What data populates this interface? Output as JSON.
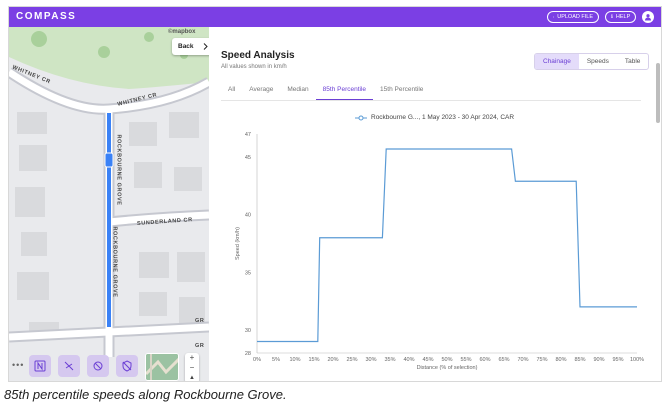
{
  "app": {
    "logo": "COMPASS",
    "upload_label": "UPLOAD FILE",
    "help_label": "HELP",
    "accent": "#7b3fe4"
  },
  "map": {
    "back_label": "Back",
    "attribution": "©mapbox",
    "streets": {
      "whitney_upper": "WHITNEY CR",
      "whitney_lower": "WHITNEY CR",
      "rockbourne_upper": "ROCKBOURNE GROVE",
      "rockbourne_lower": "ROCKBOURNE GROVE",
      "sunderland": "SUNDERLAND CR",
      "gr_upper": "GR",
      "gr_lower": "GR"
    },
    "route_color": "#3b82f6"
  },
  "panel": {
    "title": "Speed Analysis",
    "subtitle": "All values shown in km/h",
    "view_toggle": [
      "Chainage",
      "Speeds",
      "Table"
    ],
    "active_view": "Chainage",
    "tabs": [
      "All",
      "Average",
      "Median",
      "85th Percentile",
      "15th Percentile"
    ],
    "active_tab": "85th Percentile"
  },
  "chart_data": {
    "type": "line",
    "title": "",
    "series": [
      {
        "name": "Rockbourne G..., 1 May 2023 - 30 Apr 2024, CAR",
        "color": "#5b9bd5",
        "step": true,
        "x": [
          0,
          16,
          16.5,
          33,
          34,
          67,
          68,
          84,
          85,
          100
        ],
        "y": [
          29.0,
          29.0,
          38.0,
          38.0,
          45.7,
          45.7,
          42.9,
          42.9,
          32.0,
          32.0
        ]
      }
    ],
    "xlabel": "Distance (% of selection)",
    "ylabel": "Speed (km/h)",
    "xlim": [
      0,
      100
    ],
    "ylim": [
      28,
      47
    ],
    "x_ticks": [
      "0%",
      "5%",
      "10%",
      "15%",
      "20%",
      "25%",
      "30%",
      "35%",
      "40%",
      "45%",
      "50%",
      "55%",
      "60%",
      "65%",
      "70%",
      "75%",
      "80%",
      "85%",
      "90%",
      "95%",
      "100%"
    ],
    "y_ticks": [
      28,
      30,
      35,
      40,
      45,
      47
    ],
    "grid": false
  },
  "caption": "85th percentile speeds along Rockbourne Grove."
}
